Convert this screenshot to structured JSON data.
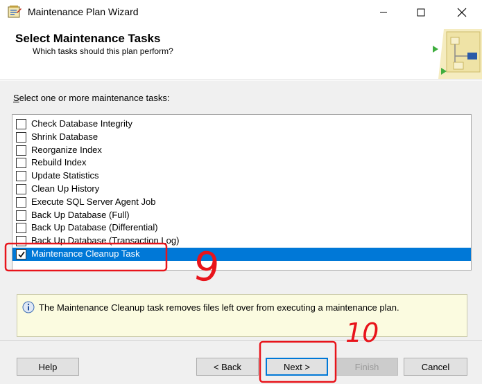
{
  "window": {
    "title": "Maintenance Plan Wizard",
    "controls": [
      "minimize",
      "maximize",
      "close"
    ]
  },
  "header": {
    "title": "Select Maintenance Tasks",
    "subtitle": "Which tasks should this plan perform?"
  },
  "task_list": {
    "label_prefix": "S",
    "label_rest": "elect one or more maintenance tasks:",
    "items": [
      {
        "label": "Check Database Integrity",
        "checked": false,
        "selected": false
      },
      {
        "label": "Shrink Database",
        "checked": false,
        "selected": false
      },
      {
        "label": "Reorganize Index",
        "checked": false,
        "selected": false
      },
      {
        "label": "Rebuild Index",
        "checked": false,
        "selected": false
      },
      {
        "label": "Update Statistics",
        "checked": false,
        "selected": false
      },
      {
        "label": "Clean Up History",
        "checked": false,
        "selected": false
      },
      {
        "label": "Execute SQL Server Agent Job",
        "checked": false,
        "selected": false
      },
      {
        "label": "Back Up Database (Full)",
        "checked": false,
        "selected": false
      },
      {
        "label": "Back Up Database (Differential)",
        "checked": false,
        "selected": false
      },
      {
        "label": "Back Up Database (Transaction Log)",
        "checked": false,
        "selected": false
      },
      {
        "label": "Maintenance Cleanup Task",
        "checked": true,
        "selected": true
      }
    ]
  },
  "info": {
    "text": "The Maintenance Cleanup task removes files left over from executing a maintenance plan."
  },
  "buttons": {
    "help": "Help",
    "back": "< Back",
    "next": "Next >",
    "finish": "Finish",
    "cancel": "Cancel"
  },
  "annotations": {
    "step_9": "9",
    "step_10": "10",
    "color": "#e8141b"
  },
  "colors": {
    "selection": "#0078d7",
    "info_bg": "#fbfbe0"
  }
}
